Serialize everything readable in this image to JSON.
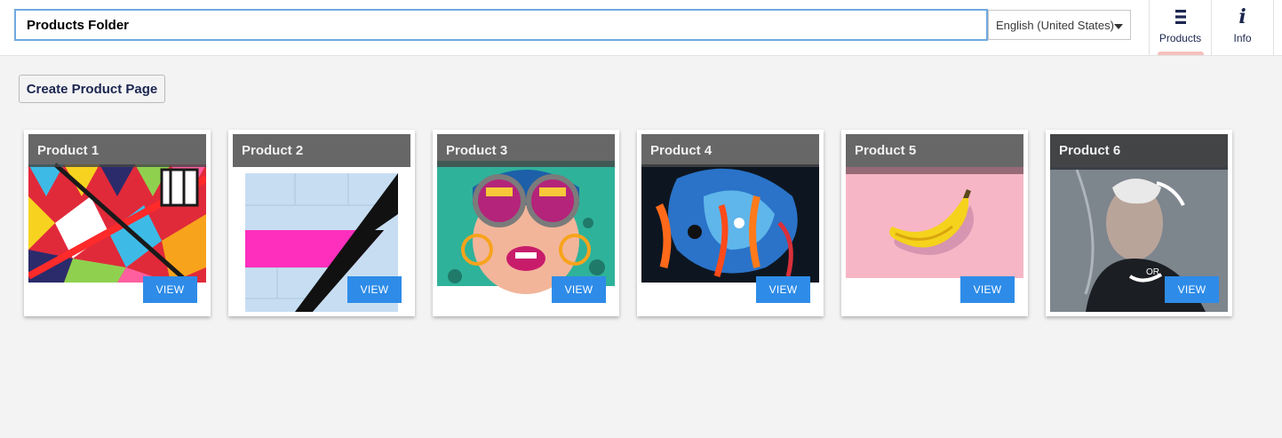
{
  "header": {
    "name_value": "Products Folder",
    "language": "English (United States)",
    "apps": [
      {
        "label": "Products",
        "icon": "list-icon",
        "active": true
      },
      {
        "label": "Info",
        "icon": "info-icon"
      }
    ]
  },
  "toolbar": {
    "create_label": "Create Product Page"
  },
  "products": [
    {
      "name": "Product 1",
      "view_label": "VIEW",
      "image": "geometric-mural-image"
    },
    {
      "name": "Product 2",
      "view_label": "VIEW",
      "image": "pink-wall-stripe-image"
    },
    {
      "name": "Product 3",
      "view_label": "VIEW",
      "image": "pop-art-sunglasses-image"
    },
    {
      "name": "Product 4",
      "view_label": "VIEW",
      "image": "abstract-paint-image"
    },
    {
      "name": "Product 5",
      "view_label": "VIEW",
      "image": "banana-image"
    },
    {
      "name": "Product 6",
      "view_label": "VIEW",
      "image": "street-art-man-image"
    }
  ],
  "colors": {
    "accent": "#2e8ce8",
    "active_tab_indicator": "#f5c1bc",
    "text_dark": "#1b264f"
  }
}
